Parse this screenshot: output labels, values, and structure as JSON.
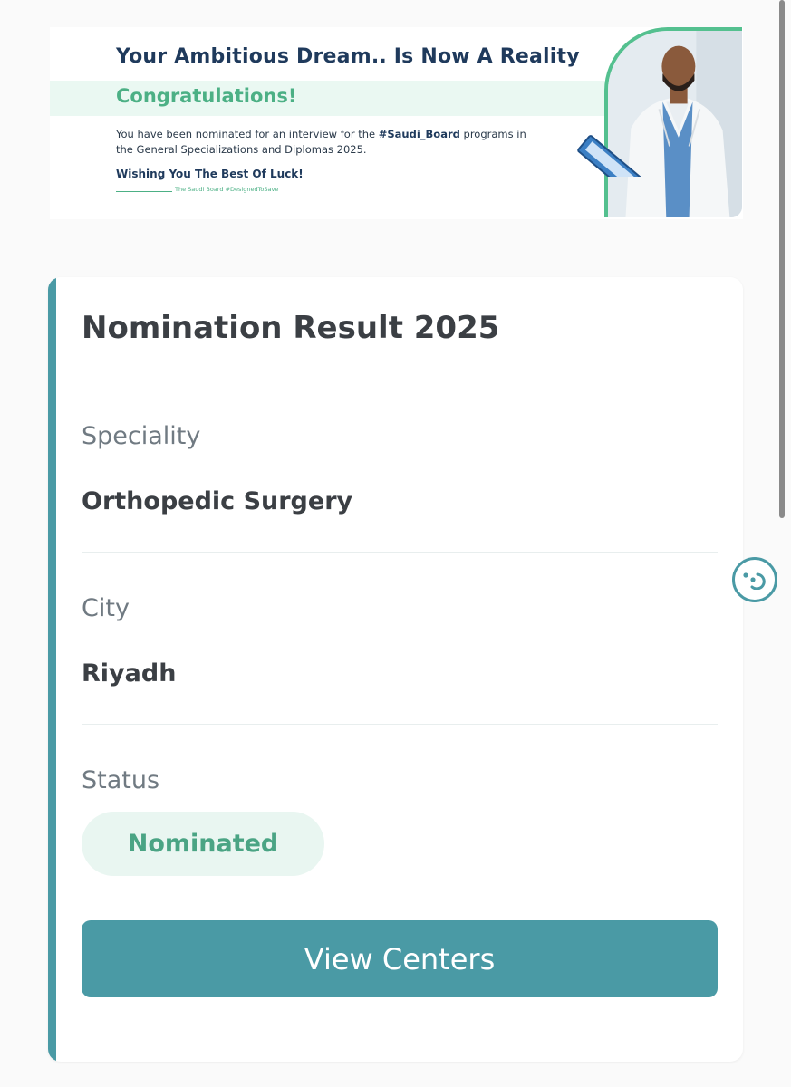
{
  "banner": {
    "headline": "Your Ambitious Dream.. Is Now A Reality",
    "congrats": "Congratulations!",
    "message_before": "You have been nominated for an interview for the ",
    "message_tag": "#Saudi_Board",
    "message_after": " programs in the General Specializations and Diplomas 2025.",
    "wish": "Wishing You The Best Of Luck!",
    "signature": "The Saudi Board #DesignedToSave"
  },
  "card": {
    "title": "Nomination Result 2025",
    "fields": [
      {
        "label": "Speciality",
        "value": "Orthopedic Surgery"
      },
      {
        "label": "City",
        "value": "Riyadh"
      },
      {
        "label": "Status",
        "value": "Nominated"
      }
    ],
    "cta_label": "View Centers"
  },
  "colors": {
    "accent": "#4a9aa5",
    "brand_green": "#4cb085",
    "status_bg": "#e9f6f1",
    "headline_navy": "#1f3a5c"
  },
  "icons": {
    "floating_button": "accessibility-icon"
  }
}
